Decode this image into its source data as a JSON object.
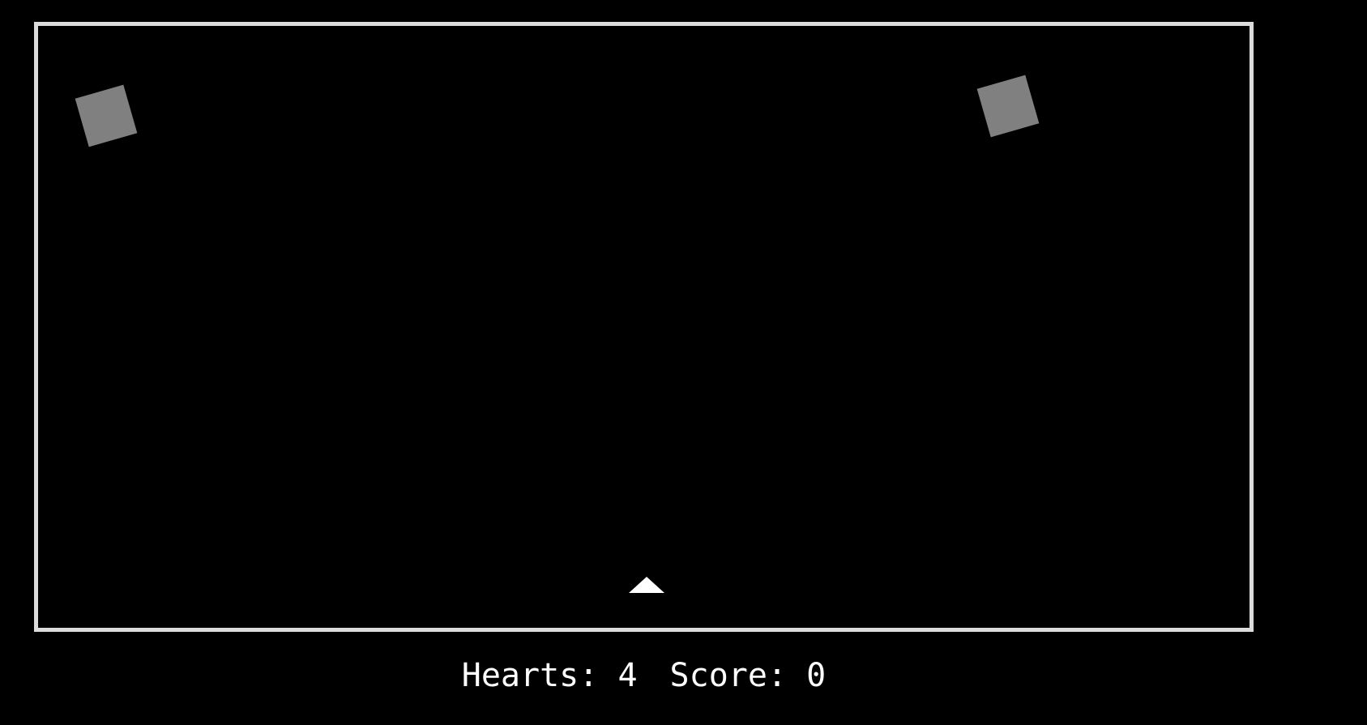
{
  "colors": {
    "background": "#000000",
    "border": "#dcdcdc",
    "asteroid": "#808080",
    "ship": "#ffffff",
    "text": "#ffffff"
  },
  "hud": {
    "hearts_label": "Hearts:",
    "hearts_value": "4",
    "score_label": "Score:",
    "score_value": "0"
  },
  "objects": {
    "asteroids": [
      {
        "icon": "rotated-square-asteroid"
      },
      {
        "icon": "rotated-square-asteroid"
      }
    ],
    "player": {
      "icon": "triangle-ship"
    }
  }
}
